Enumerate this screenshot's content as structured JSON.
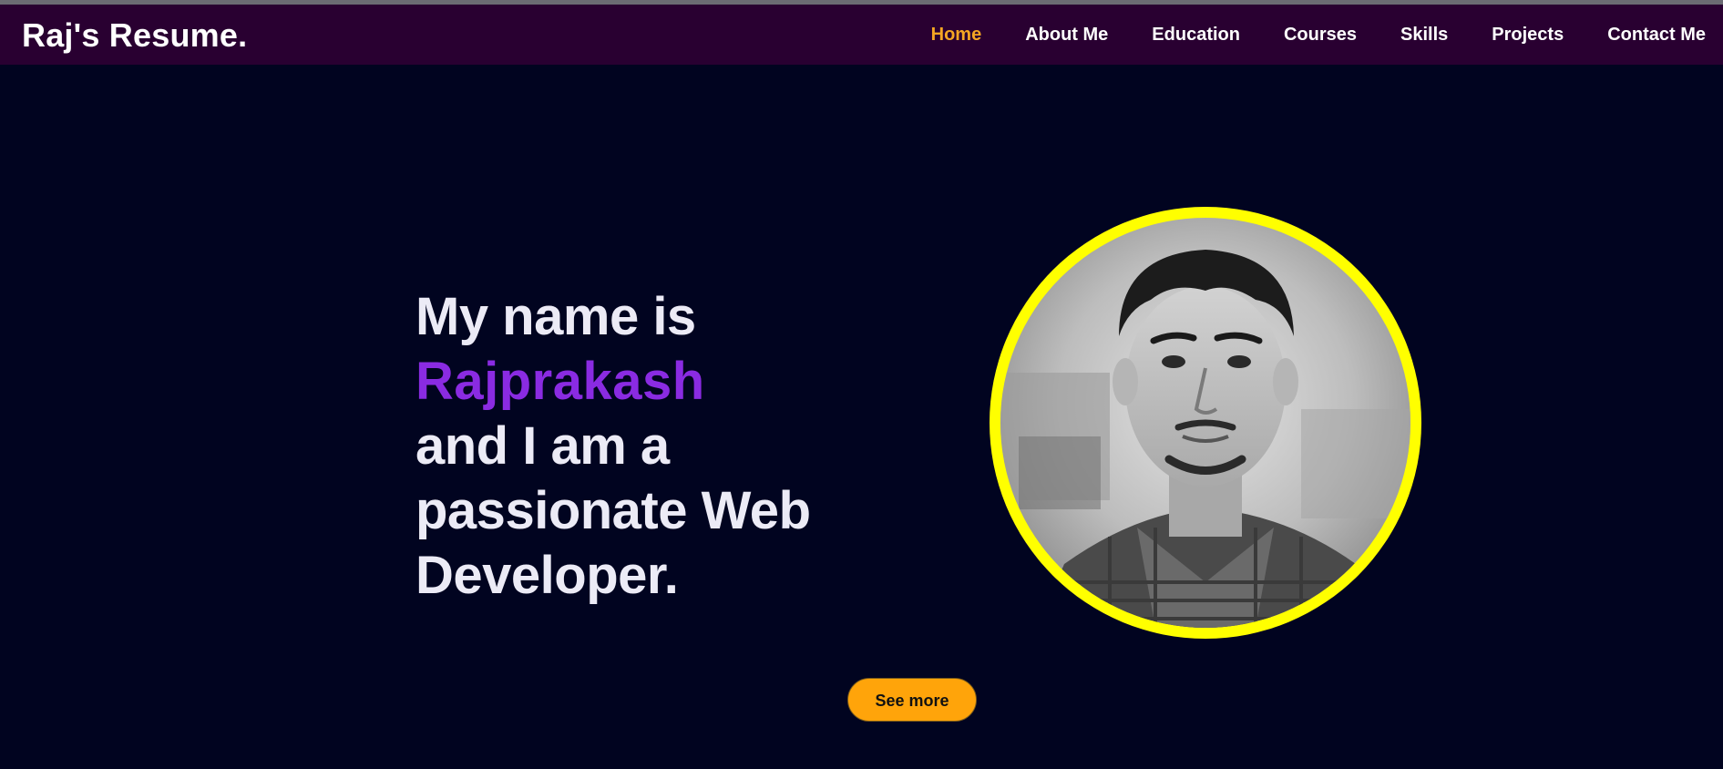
{
  "header": {
    "brand": "Raj's Resume."
  },
  "nav": {
    "items": [
      {
        "label": "Home",
        "active": true
      },
      {
        "label": "About Me",
        "active": false
      },
      {
        "label": "Education",
        "active": false
      },
      {
        "label": "Courses",
        "active": false
      },
      {
        "label": "Skills",
        "active": false
      },
      {
        "label": "Projects",
        "active": false
      },
      {
        "label": "Contact Me",
        "active": false
      }
    ]
  },
  "hero": {
    "line1": "My name is",
    "name": "Rajprakash",
    "line3": "and I am a",
    "line4": "passionate Web",
    "line5": "Developer.",
    "button_label": "See more"
  },
  "colors": {
    "background": "#010420",
    "navbar": "#290031",
    "active_nav": "#f5a623",
    "name_accent": "#8a2be2",
    "avatar_ring": "#ffff00",
    "button": "#ffa40a"
  },
  "icons": {
    "avatar": "profile-photo"
  }
}
